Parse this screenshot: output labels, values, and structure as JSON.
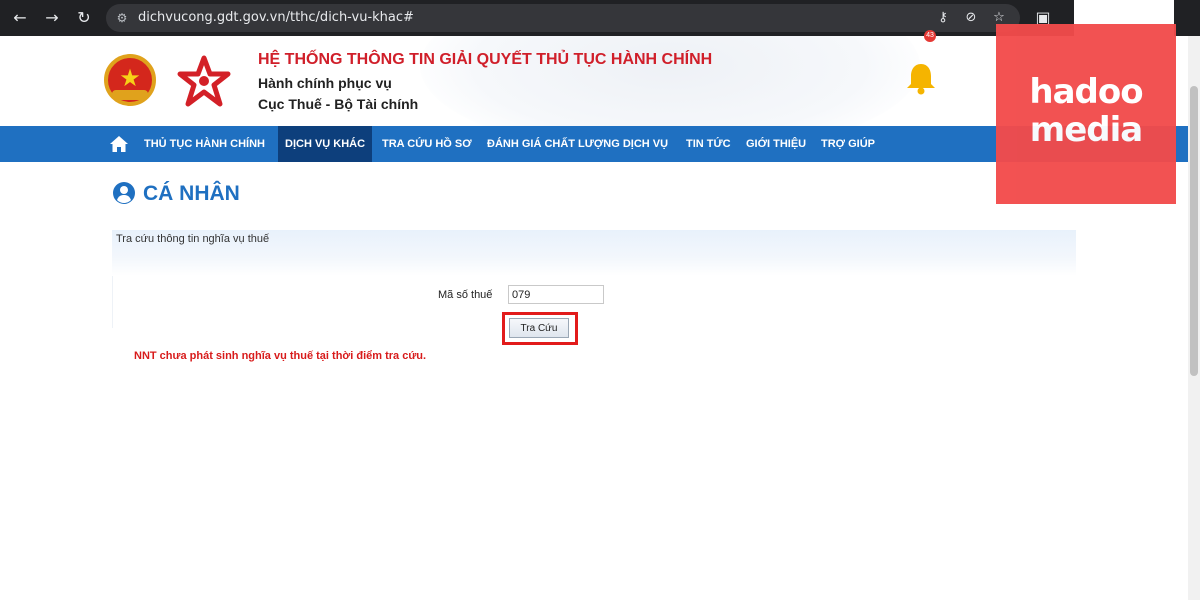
{
  "browser": {
    "url": "dichvucong.gdt.gov.vn/tthc/dich-vu-khac#",
    "back_icon": "back-arrow-icon",
    "forward_icon": "forward-arrow-icon",
    "reload_icon": "reload-icon"
  },
  "header": {
    "title": "HỆ THỐNG THÔNG TIN GIẢI QUYẾT THỦ TỤC HÀNH CHÍNH",
    "subtitle1": "Hành chính phục vụ",
    "subtitle2": "Cục Thuế - Bộ Tài chính",
    "notification_count": "43"
  },
  "watermark": {
    "line1": "hadoo",
    "line2": "media"
  },
  "nav": {
    "items": [
      {
        "label": "THỦ TỤC HÀNH CHÍNH"
      },
      {
        "label": "DỊCH VỤ KHÁC"
      },
      {
        "label": "TRA CỨU HỒ SƠ"
      },
      {
        "label": "ĐÁNH GIÁ CHẤT LƯỢNG DỊCH VỤ"
      },
      {
        "label": "TIN TỨC"
      },
      {
        "label": "GIỚI THIỆU"
      },
      {
        "label": "TRỢ GIÚP"
      }
    ],
    "active_index": 1
  },
  "main": {
    "page_title": "CÁ NHÂN",
    "panel_title": "Tra cứu thông tin nghĩa vụ thuế",
    "tax_code_label": "Mã số thuế",
    "tax_code_value": "079",
    "lookup_button": "Tra Cứu",
    "result_message": "NNT chưa phát sinh nghĩa vụ thuế tại thời điểm tra cứu."
  },
  "colors": {
    "nav_bg": "#1f70c1",
    "nav_active": "#0d3f7c",
    "title_red": "#d01f2a",
    "page_title_blue": "#1f70c1",
    "highlight_red": "#e21b1b"
  }
}
